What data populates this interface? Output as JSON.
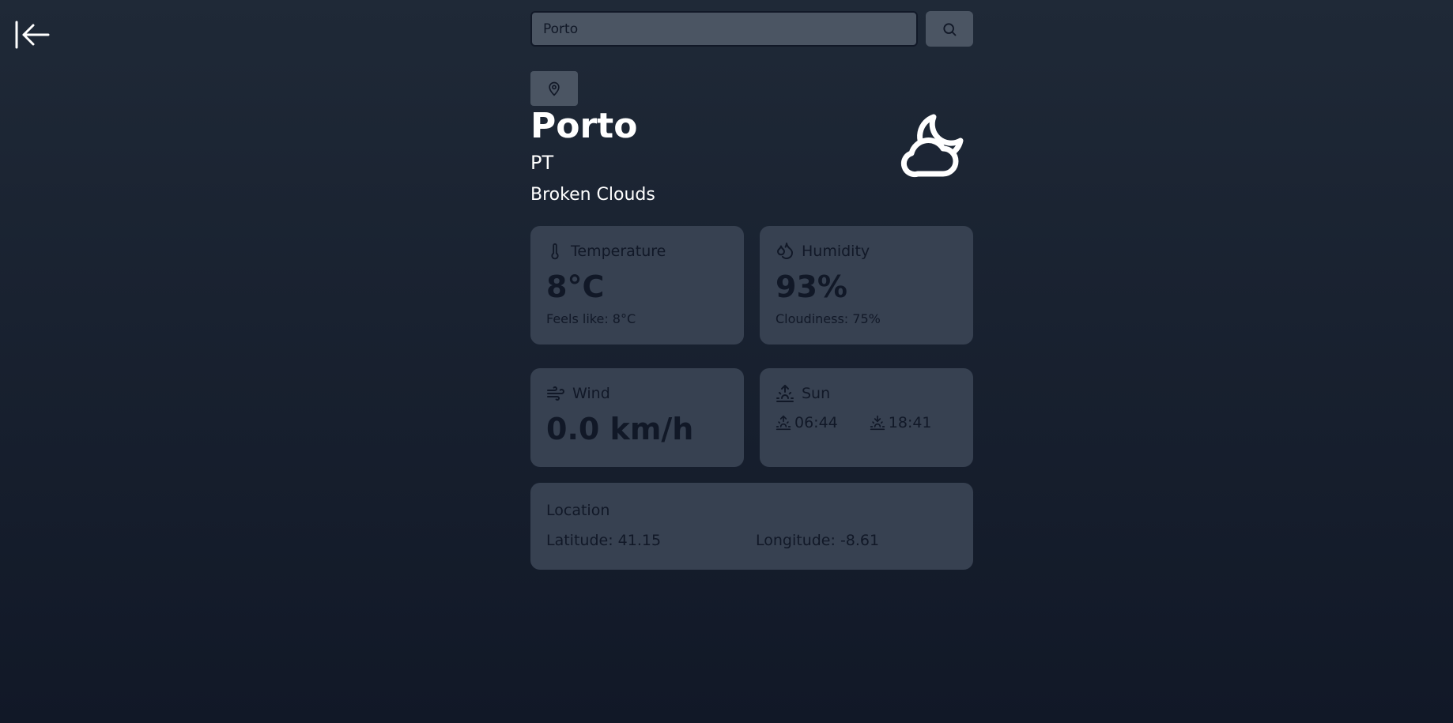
{
  "search": {
    "value": "Porto",
    "icon": "search-icon"
  },
  "navigation": {
    "back_icon": "arrow-left-to-line-icon",
    "location_icon": "map-pin-icon"
  },
  "current": {
    "city": "Porto",
    "country": "PT",
    "description": "Broken Clouds",
    "icon": "cloud-moon-icon"
  },
  "temperature": {
    "label": "Temperature",
    "value": "8°C",
    "feels_like": "Feels like: 8°C",
    "icon": "thermometer-icon"
  },
  "humidity": {
    "label": "Humidity",
    "value": "93%",
    "cloudiness": "Cloudiness: 75%",
    "icon": "droplets-icon"
  },
  "wind": {
    "label": "Wind",
    "value": "0.0 km/h",
    "icon": "wind-icon"
  },
  "sun": {
    "label": "Sun",
    "sunrise": "06:44",
    "sunset": "18:41",
    "icon": "sunrise-icon"
  },
  "location": {
    "label": "Location",
    "latitude": "Latitude: 41.15",
    "longitude": "Longitude: -8.61"
  },
  "colors": {
    "background_top": "#1f2937",
    "background_bottom": "#111827",
    "card": "#374151",
    "input": "#4b5563",
    "card_text": "#111827",
    "header_text": "#ffffff"
  }
}
